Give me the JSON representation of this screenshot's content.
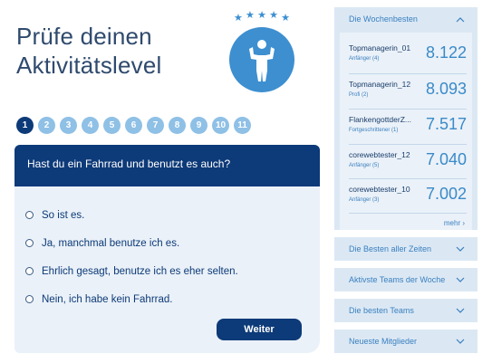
{
  "header": {
    "title_line1": "Prüfe deinen",
    "title_line2": "Aktivitätslevel"
  },
  "badge": {
    "stars": [
      "★",
      "★",
      "★",
      "★",
      "★"
    ],
    "icon": "strongman-icon"
  },
  "steps": {
    "items": [
      "1",
      "2",
      "3",
      "4",
      "5",
      "6",
      "7",
      "8",
      "9",
      "10",
      "11"
    ],
    "active": "1"
  },
  "quiz": {
    "question": "Hast du ein Fahrrad und benutzt es auch?",
    "answers": [
      "So ist es.",
      "Ja, manchmal benutze ich es.",
      "Ehrlich gesagt, benutze ich es eher selten.",
      "Nein, ich habe kein Fahrrad."
    ],
    "next_label": "Weiter"
  },
  "sidebar": {
    "leaderboard": {
      "title": "Die Wochenbesten",
      "rows": [
        {
          "name": "Topmanagerin_01",
          "level": "Anfänger (4)",
          "score": "8.122"
        },
        {
          "name": "Topmanagerin_12",
          "level": "Profi (2)",
          "score": "8.093"
        },
        {
          "name": "FlankengottderZ...",
          "level": "Fortgeschrittener (1)",
          "score": "7.517"
        },
        {
          "name": "corewebtester_12",
          "level": "Anfänger (5)",
          "score": "7.040"
        },
        {
          "name": "corewebtester_10",
          "level": "Anfänger (3)",
          "score": "7.002"
        }
      ],
      "more_label": "mehr ›"
    },
    "accordions": [
      "Die Besten aller Zeiten",
      "Aktivste Teams der Woche",
      "Die besten Teams",
      "Neueste Mitglieder"
    ]
  },
  "colors": {
    "primary": "#0d3a78",
    "accent": "#3d8fd0",
    "step_inactive": "#8fc0e6",
    "panel_bg": "#eaf1f8",
    "sidebar_bg": "#dbe8f4"
  }
}
